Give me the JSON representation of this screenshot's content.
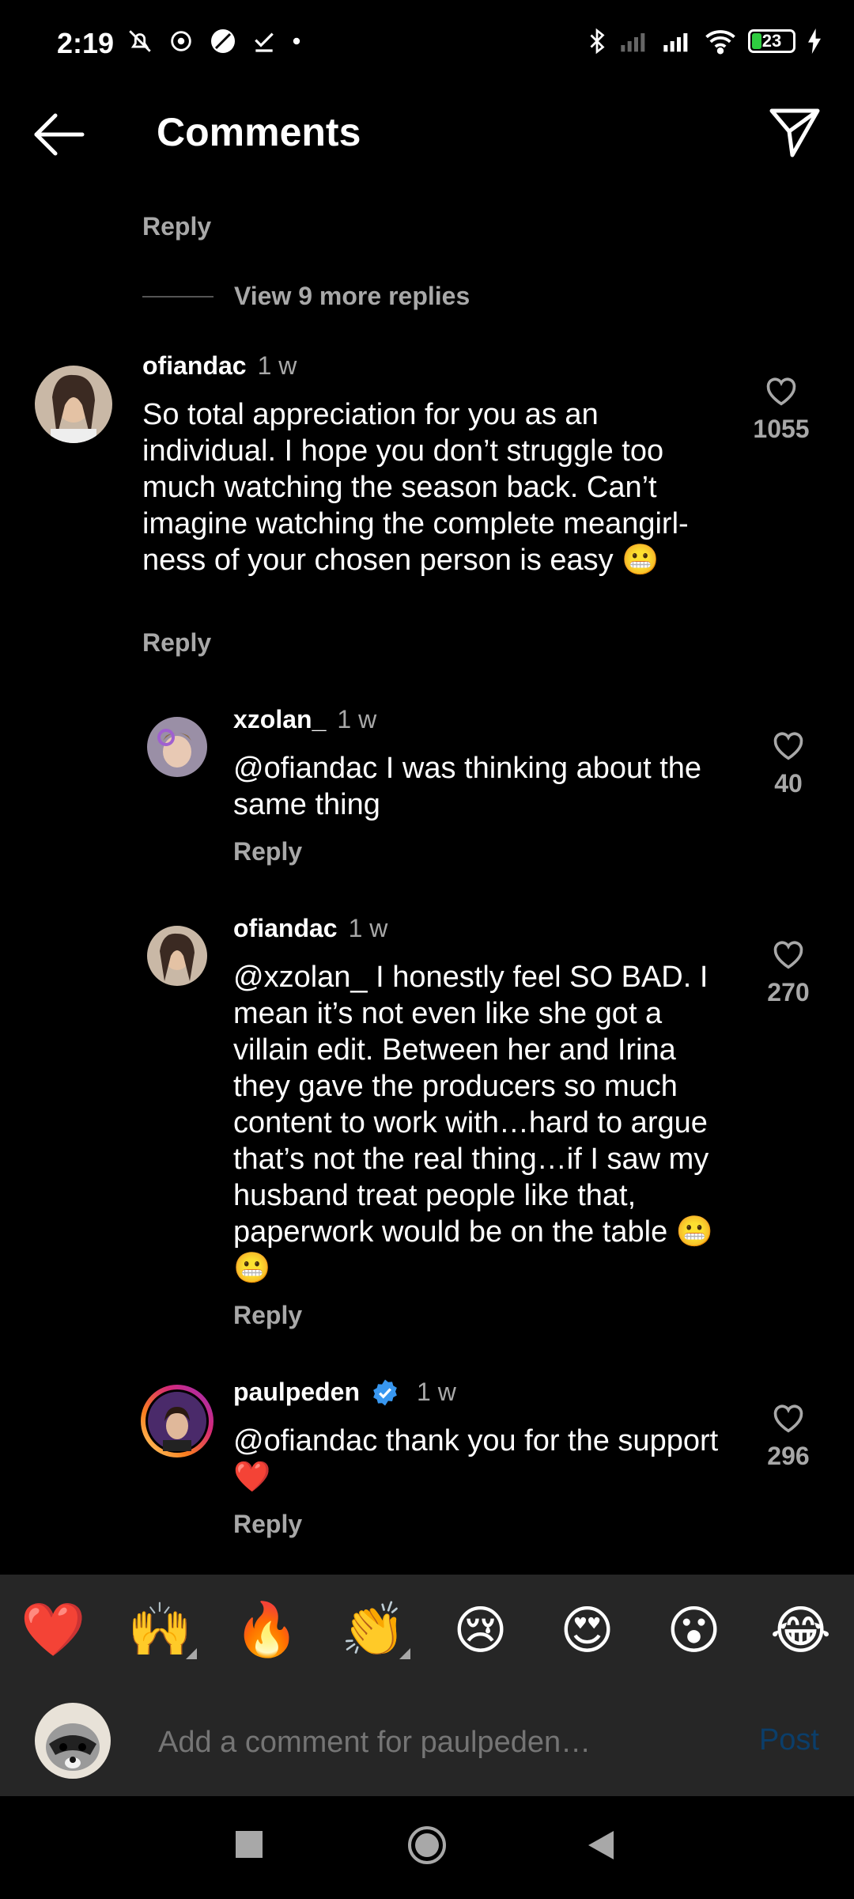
{
  "status_bar": {
    "time": "2:19",
    "battery": "23"
  },
  "header": {
    "title": "Comments"
  },
  "top_reply": "Reply",
  "view_more": "View 9 more replies",
  "comments": [
    {
      "user": "ofiandac",
      "time": "1 w",
      "text": "So total appreciation for you as an individual. I hope you don’t struggle too much watching the season back. Can’t imagine watching the complete meangirl-ness of your chosen person is easy 😬",
      "likes": "1055",
      "reply": "Reply"
    },
    {
      "user": "xzolan_",
      "time": "1 w",
      "text": "@ofiandac I was thinking about the same thing",
      "likes": "40",
      "reply": "Reply"
    },
    {
      "user": "ofiandac",
      "time": "1 w",
      "text": "@xzolan_ I honestly feel SO BAD. I mean it’s not even like she got a villain edit. Between her and Irina they gave the producers so much content to work with…hard to argue that’s not the real thing…if I saw my husband treat people like that, paperwork would be on the table 😬 😬",
      "likes": "270",
      "reply": "Reply"
    },
    {
      "user": "paulpeden",
      "time": "1 w",
      "text": "@ofiandac thank you for the support ❤️",
      "likes": "296",
      "reply": "Reply",
      "verified": true
    }
  ],
  "emoji_reactions": [
    "❤️",
    "🙌",
    "🔥",
    "👏",
    "😢",
    "😍",
    "😮",
    "😂"
  ],
  "comment_input": {
    "placeholder": "Add a comment for paulpeden…",
    "post_label": "Post"
  },
  "colors": {
    "background": "#000000",
    "secondary_text": "#a8a8a8",
    "panel": "#262626",
    "post_disabled": "#0b3e6a",
    "verified": "#3897f0"
  }
}
